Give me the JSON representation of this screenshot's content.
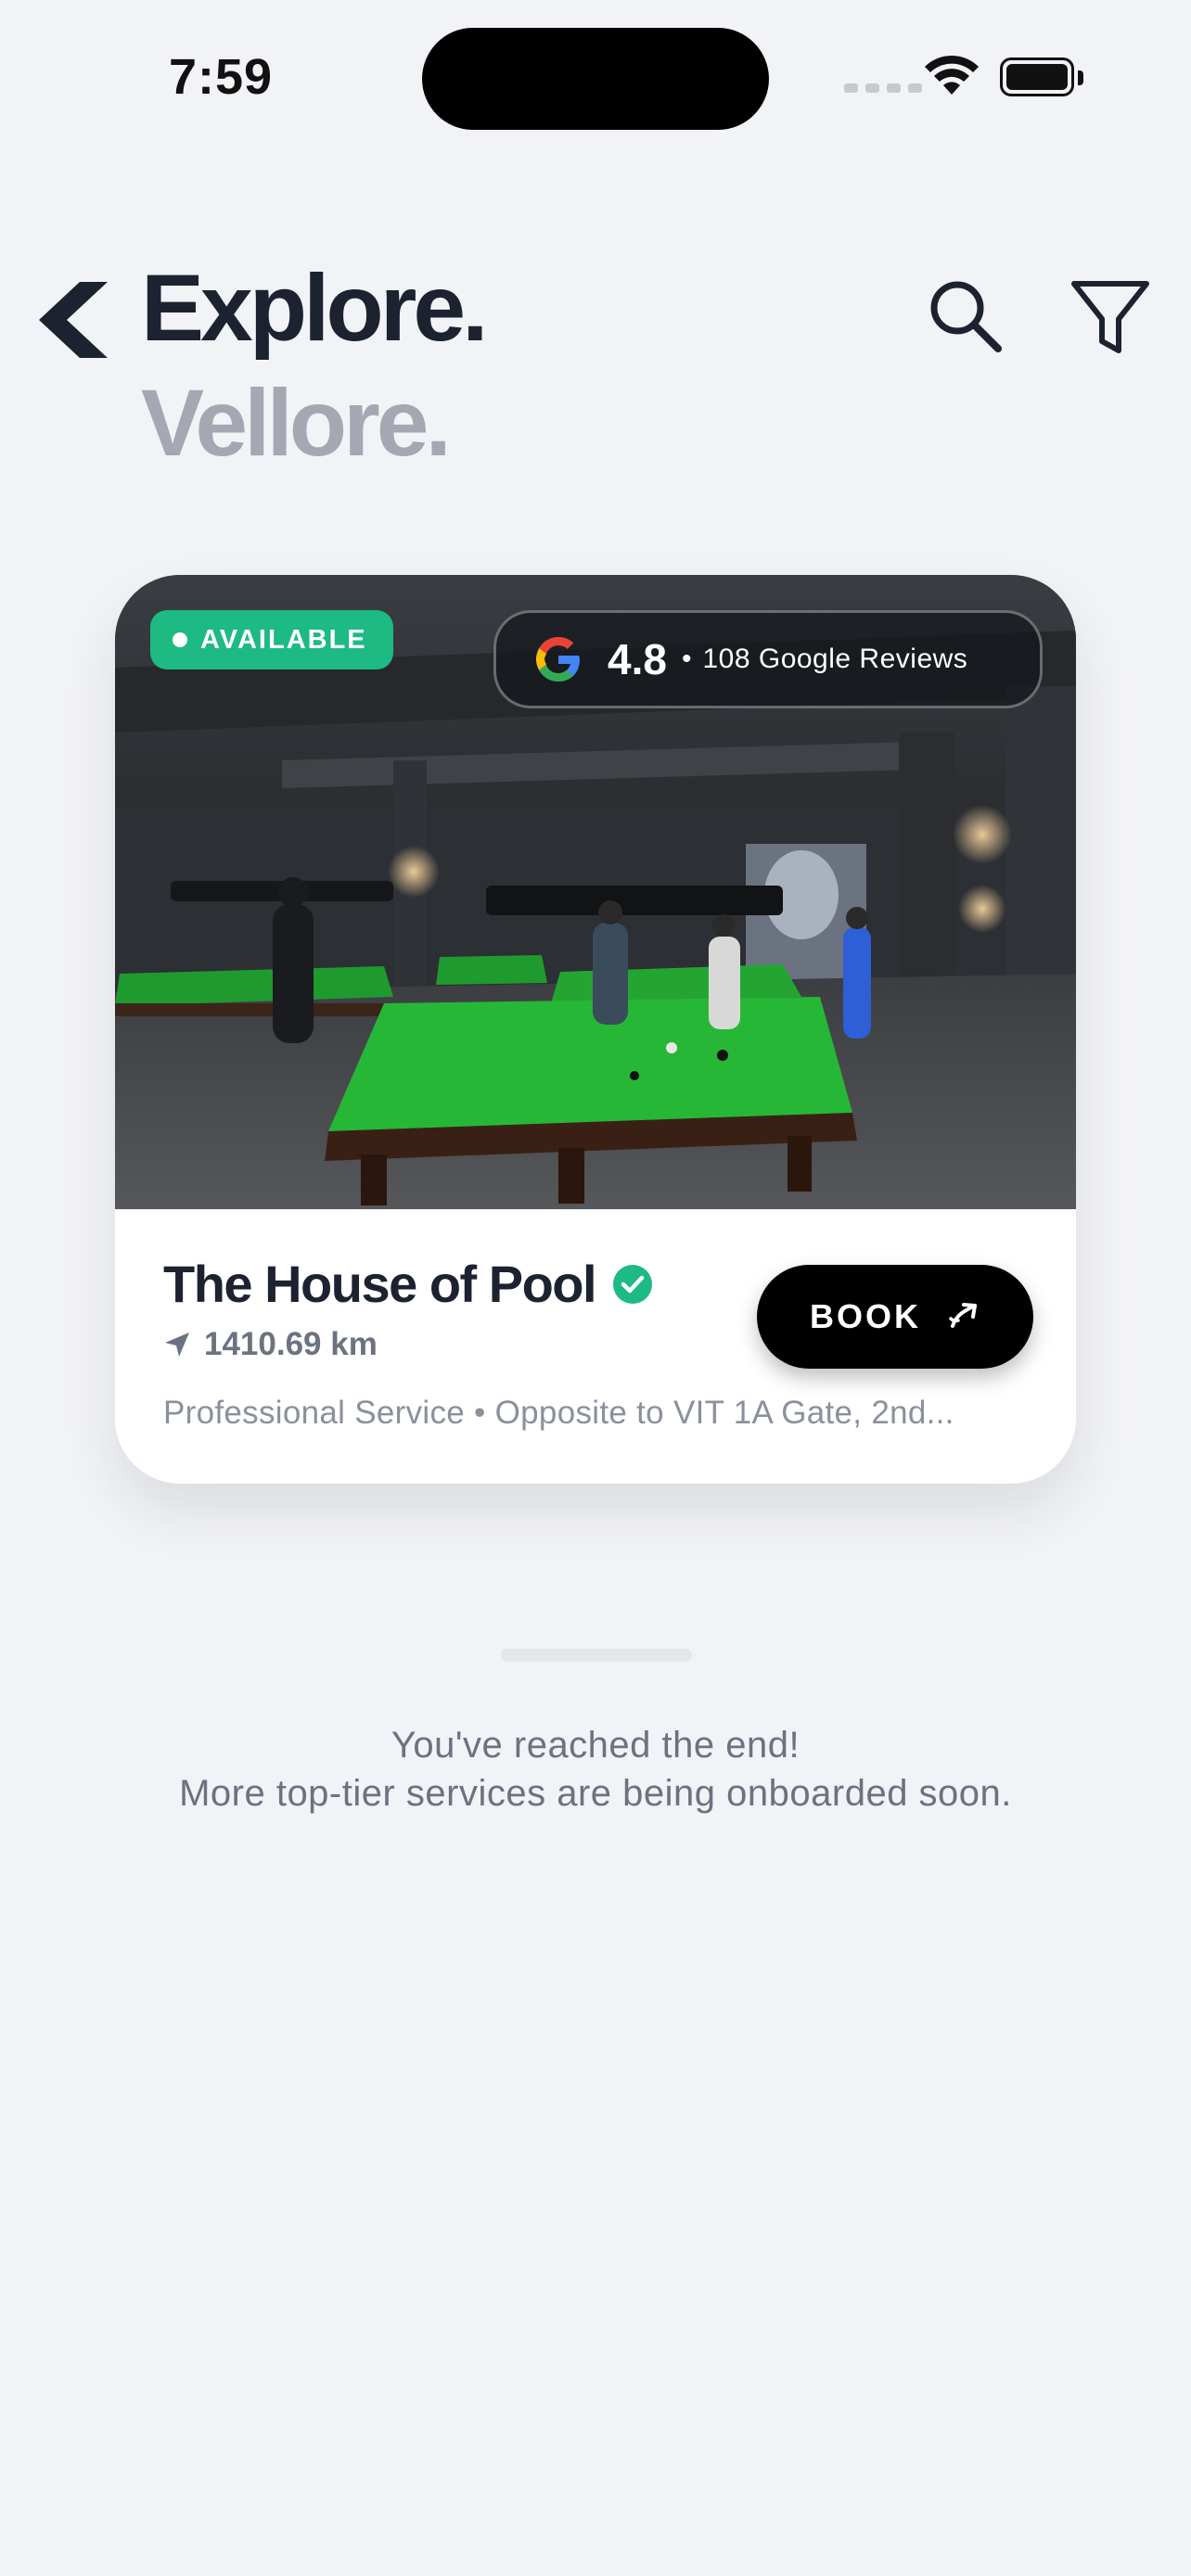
{
  "status_bar": {
    "time": "7:59"
  },
  "header": {
    "title": "Explore.",
    "subtitle": "Vellore."
  },
  "listing": {
    "status_badge": "AVAILABLE",
    "rating": "4.8",
    "rating_separator": "•",
    "reviews_label": "108 Google Reviews",
    "name": "The House of Pool",
    "verified": true,
    "distance": "1410.69 km",
    "description": "Professional Service • Opposite to VIT 1A Gate, 2nd...",
    "book_label": "BOOK",
    "image_description": "pool hall with green snooker tables",
    "colors": {
      "available": "#1dba83",
      "verified": "#1dba83",
      "button": "#000000"
    }
  },
  "footer": {
    "line1": "You've reached the end!",
    "line2": "More top-tier services are being onboarded soon."
  },
  "icons": {
    "back": "chevron-left-icon",
    "search": "search-icon",
    "filter": "filter-icon",
    "location": "location-arrow-icon",
    "book": "arrow-up-right-icon",
    "google": "google-icon",
    "verified": "check-circle-icon"
  }
}
